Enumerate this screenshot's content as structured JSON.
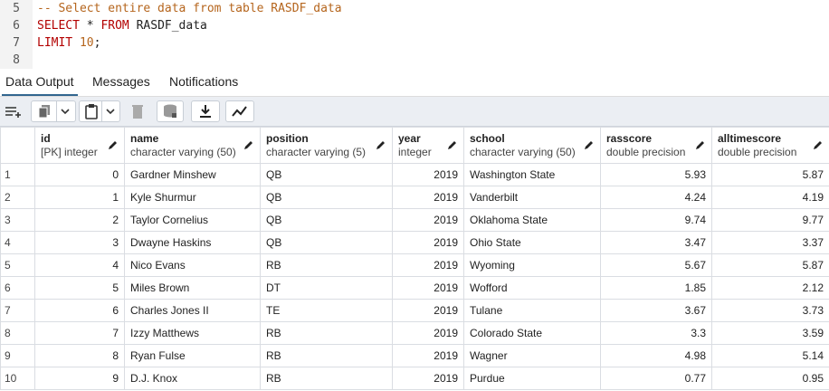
{
  "editor": {
    "lines": [
      {
        "num": "5",
        "tokens": [
          {
            "t": "comment",
            "v": "-- Select entire data from table RASDF_data"
          }
        ]
      },
      {
        "num": "6",
        "tokens": [
          {
            "t": "kw",
            "v": "SELECT"
          },
          {
            "t": "plain",
            "v": " * "
          },
          {
            "t": "kw",
            "v": "FROM"
          },
          {
            "t": "plain",
            "v": " RASDF_data"
          }
        ]
      },
      {
        "num": "7",
        "tokens": [
          {
            "t": "kw",
            "v": "LIMIT"
          },
          {
            "t": "plain",
            "v": " "
          },
          {
            "t": "num",
            "v": "10"
          },
          {
            "t": "plain",
            "v": ";"
          }
        ]
      },
      {
        "num": "8",
        "tokens": []
      }
    ]
  },
  "tabs": [
    {
      "label": "Data Output",
      "active": true
    },
    {
      "label": "Messages",
      "active": false
    },
    {
      "label": "Notifications",
      "active": false
    }
  ],
  "toolbar": {
    "buttons": [
      "add-row-icon",
      "copy-icon",
      "chevron-down-icon",
      "paste-icon",
      "chevron-down-icon",
      "delete-icon",
      "save-data-icon",
      "download-icon",
      "graph-visualiser-icon"
    ]
  },
  "grid": {
    "columns": [
      {
        "name": "id",
        "type": "[PK] integer"
      },
      {
        "name": "name",
        "type": "character varying (50)"
      },
      {
        "name": "position",
        "type": "character varying (5)"
      },
      {
        "name": "year",
        "type": "integer"
      },
      {
        "name": "school",
        "type": "character varying (50)"
      },
      {
        "name": "rasscore",
        "type": "double precision"
      },
      {
        "name": "alltimescore",
        "type": "double precision"
      }
    ],
    "rows": [
      [
        "1",
        "0",
        "Gardner Minshew",
        "QB",
        "2019",
        "Washington State",
        "5.93",
        "5.87"
      ],
      [
        "2",
        "1",
        "Kyle Shurmur",
        "QB",
        "2019",
        "Vanderbilt",
        "4.24",
        "4.19"
      ],
      [
        "3",
        "2",
        "Taylor Cornelius",
        "QB",
        "2019",
        "Oklahoma State",
        "9.74",
        "9.77"
      ],
      [
        "4",
        "3",
        "Dwayne Haskins",
        "QB",
        "2019",
        "Ohio State",
        "3.47",
        "3.37"
      ],
      [
        "5",
        "4",
        "Nico Evans",
        "RB",
        "2019",
        "Wyoming",
        "5.67",
        "5.87"
      ],
      [
        "6",
        "5",
        "Miles Brown",
        "DT",
        "2019",
        "Wofford",
        "1.85",
        "2.12"
      ],
      [
        "7",
        "6",
        "Charles Jones II",
        "TE",
        "2019",
        "Tulane",
        "3.67",
        "3.73"
      ],
      [
        "8",
        "7",
        "Izzy Matthews",
        "RB",
        "2019",
        "Colorado State",
        "3.3",
        "3.59"
      ],
      [
        "9",
        "8",
        "Ryan Fulse",
        "RB",
        "2019",
        "Wagner",
        "4.98",
        "5.14"
      ],
      [
        "10",
        "9",
        "D.J. Knox",
        "RB",
        "2019",
        "Purdue",
        "0.77",
        "0.95"
      ]
    ]
  }
}
